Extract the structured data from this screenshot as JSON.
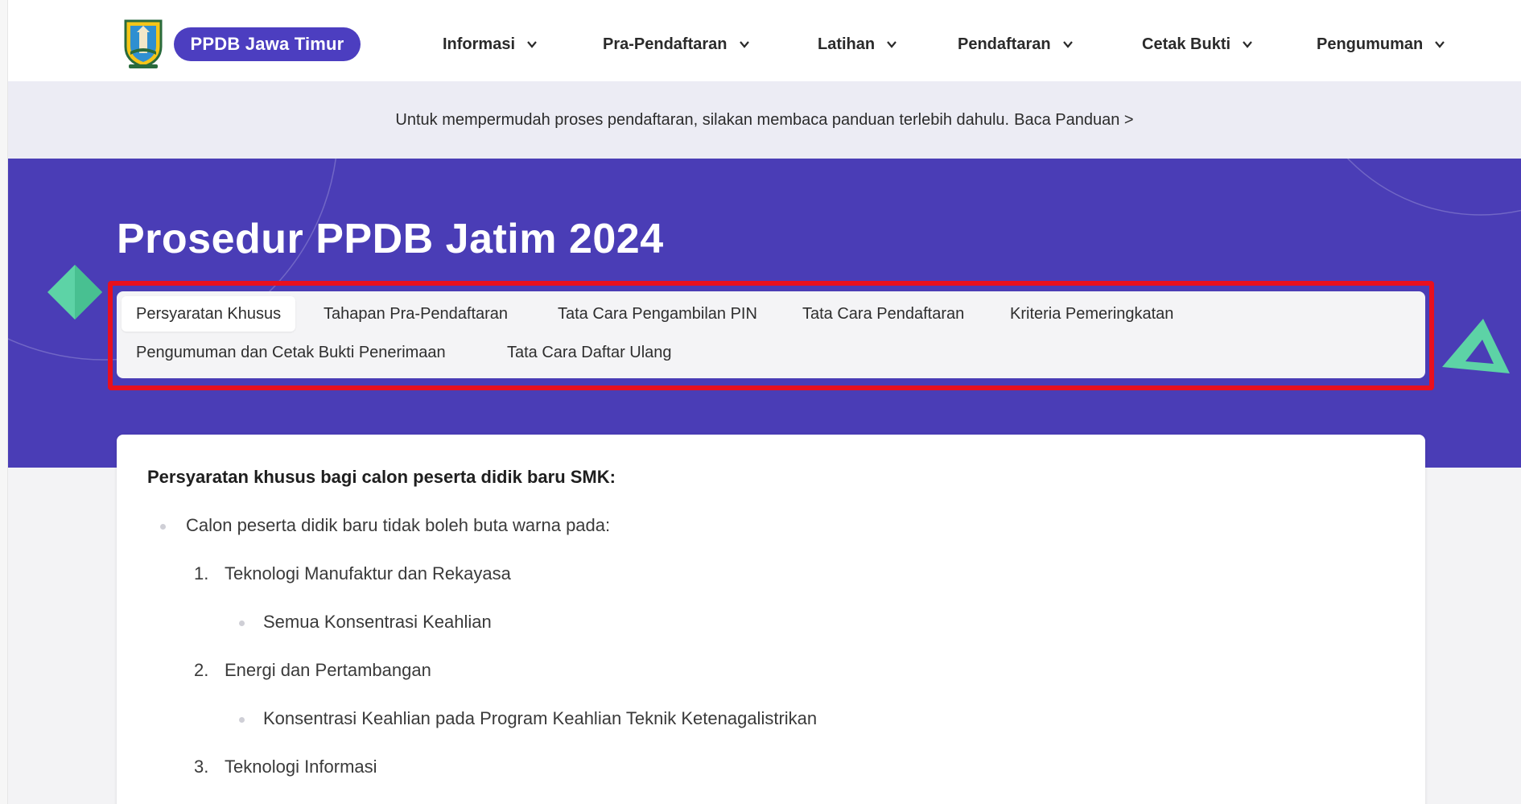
{
  "nav": {
    "brand": "PPDB Jawa Timur",
    "items": [
      {
        "label": "Informasi"
      },
      {
        "label": "Pra-Pendaftaran"
      },
      {
        "label": "Latihan"
      },
      {
        "label": "Pendaftaran"
      },
      {
        "label": "Cetak Bukti"
      },
      {
        "label": "Pengumuman"
      }
    ]
  },
  "banner": {
    "text": "Untuk mempermudah proses pendaftaran, silakan membaca panduan terlebih dahulu.",
    "link": "Baca Panduan >"
  },
  "hero": {
    "title": "Prosedur PPDB Jatim 2024"
  },
  "tabs": [
    {
      "label": "Persyaratan Khusus",
      "active": true
    },
    {
      "label": "Tahapan Pra-Pendaftaran"
    },
    {
      "label": "Tata Cara Pengambilan PIN"
    },
    {
      "label": "Tata Cara Pendaftaran"
    },
    {
      "label": "Kriteria Pemeringkatan"
    },
    {
      "label": "Pengumuman dan Cetak Bukti Penerimaan"
    },
    {
      "label": "Tata Cara Daftar Ulang"
    }
  ],
  "content": {
    "heading": "Persyaratan khusus bagi calon peserta didik baru SMK:",
    "bullet": "Calon peserta didik baru tidak boleh buta warna pada:",
    "items": [
      {
        "num": "1.",
        "label": "Teknologi Manufaktur dan Rekayasa",
        "sub": "Semua Konsentrasi Keahlian"
      },
      {
        "num": "2.",
        "label": "Energi dan Pertambangan",
        "sub": "Konsentrasi Keahlian pada Program Keahlian Teknik Ketenagalistrikan"
      },
      {
        "num": "3.",
        "label": "Teknologi Informasi"
      }
    ]
  },
  "colors": {
    "brand": "#4c3ec0",
    "hero": "#4a3db6",
    "highlight": "#e8101e",
    "accent_green": "#5dd3a6"
  }
}
